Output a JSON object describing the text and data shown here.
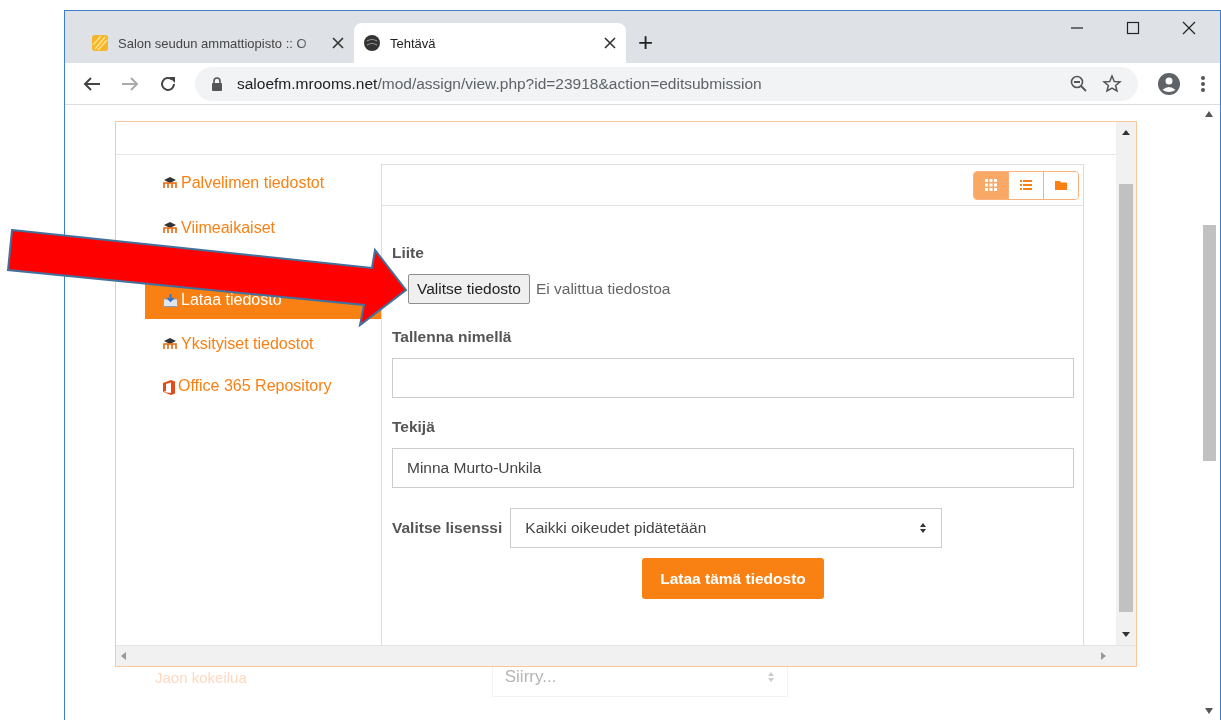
{
  "browser": {
    "tabs": [
      {
        "title": "Salon seudun ammattiopisto :: O",
        "kind": "stripes",
        "selected": false
      },
      {
        "title": "Tehtävä",
        "kind": "swirl",
        "selected": true
      }
    ],
    "new_tab": "+",
    "url": {
      "host": "saloefm.mrooms.net",
      "path": "/mod/assign/view.php?id=23918&action=editsubmission"
    }
  },
  "background_page": {
    "link": "Jaon kokeilua",
    "select": "Siirry..."
  },
  "file_picker": {
    "repositories": [
      {
        "label": "Palvelimen tiedostot",
        "kind": "moodle",
        "selected": false
      },
      {
        "label": "Viimeaikaiset",
        "kind": "moodle",
        "selected": false
      },
      {
        "label": "Lataa tiedosto",
        "kind": "upload",
        "selected": true
      },
      {
        "label": "Yksityiset tiedostot",
        "kind": "moodle",
        "selected": false
      },
      {
        "label": "Office 365 Repository",
        "kind": "office",
        "selected": false
      }
    ],
    "view_buttons": [
      {
        "kind": "grid",
        "selected": true
      },
      {
        "kind": "list",
        "selected": false
      },
      {
        "kind": "folder",
        "selected": false
      }
    ],
    "attachment": {
      "label": "Liite",
      "button": "Valitse tiedosto",
      "status": "Ei valittua tiedostoa"
    },
    "save_as": {
      "label": "Tallenna nimellä"
    },
    "author": {
      "label": "Tekijä",
      "value": "Minna Murto-Unkila"
    },
    "license": {
      "label": "Valitse lisenssi",
      "value": "Kaikki oikeudet pidätetään"
    },
    "upload_button": "Lataa tämä tiedosto"
  },
  "annotation": {
    "kind": "arrow"
  }
}
